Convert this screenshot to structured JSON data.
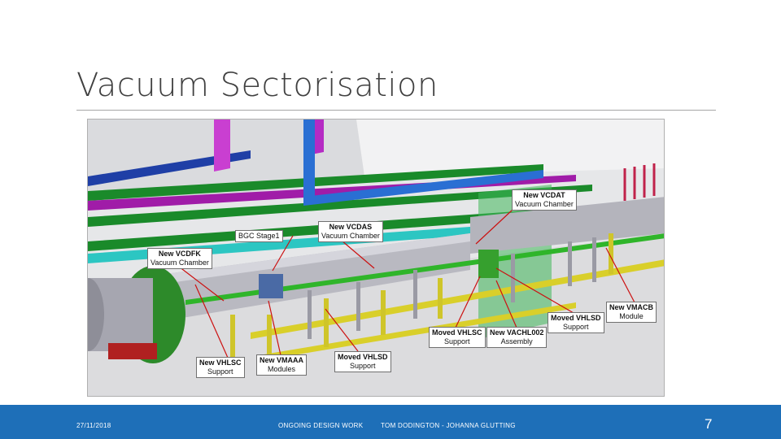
{
  "slide": {
    "title": "Vacuum Sectorisation",
    "footer": {
      "date": "27/11/2018",
      "section": "ONGOING DESIGN WORK",
      "authors": "TOM DODINGTON - JOHANNA GLUTTING",
      "page_number": "7"
    }
  },
  "figure": {
    "labels": [
      {
        "line1": "New VCDAT",
        "line2": "Vacuum Chamber"
      },
      {
        "line1": "New VCDAS",
        "line2": "Vacuum Chamber"
      },
      {
        "line1": "BGC Stage1",
        "line2": ""
      },
      {
        "line1": "New VCDFK",
        "line2": "Vacuum Chamber"
      },
      {
        "line1": "New VMACB",
        "line2": "Module"
      },
      {
        "line1": "Moved VHLSD",
        "line2": "Support"
      },
      {
        "line1": "Moved VHLSC",
        "line2": "Support"
      },
      {
        "line1": "New VACHL002",
        "line2": "Assembly"
      },
      {
        "line1": "New VHLSC",
        "line2": "Support"
      },
      {
        "line1": "New VMAAA",
        "line2": "Modules"
      },
      {
        "line1": "Moved VHLSD",
        "line2": "Support"
      }
    ]
  },
  "colors": {
    "accent": "#1e6fb8",
    "beam_pipe": "#2fb52a",
    "support_yellow": "#d9cf2a",
    "callout_arrow": "#cc1111"
  }
}
